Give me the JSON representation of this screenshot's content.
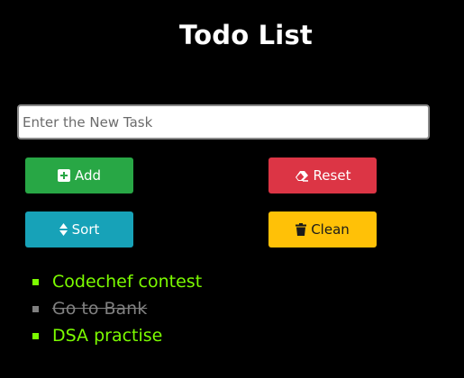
{
  "title": "Todo List",
  "input": {
    "placeholder": "Enter the New Task",
    "value": ""
  },
  "buttons": {
    "add": {
      "label": "Add",
      "icon": "plus-square-icon",
      "color": "#28a745"
    },
    "reset": {
      "label": "Reset",
      "icon": "eraser-icon",
      "color": "#dc3545"
    },
    "sort": {
      "label": "Sort",
      "icon": "sort-icon",
      "color": "#17a2b8"
    },
    "clean": {
      "label": "Clean",
      "icon": "trash-icon",
      "color": "#ffc107"
    }
  },
  "tasks": [
    {
      "text": "Codechef contest",
      "done": false
    },
    {
      "text": "Go to Bank",
      "done": true
    },
    {
      "text": "DSA practise",
      "done": false
    }
  ],
  "colors": {
    "background": "#000000",
    "task_active": "#7cfc00",
    "task_done": "#808080"
  }
}
